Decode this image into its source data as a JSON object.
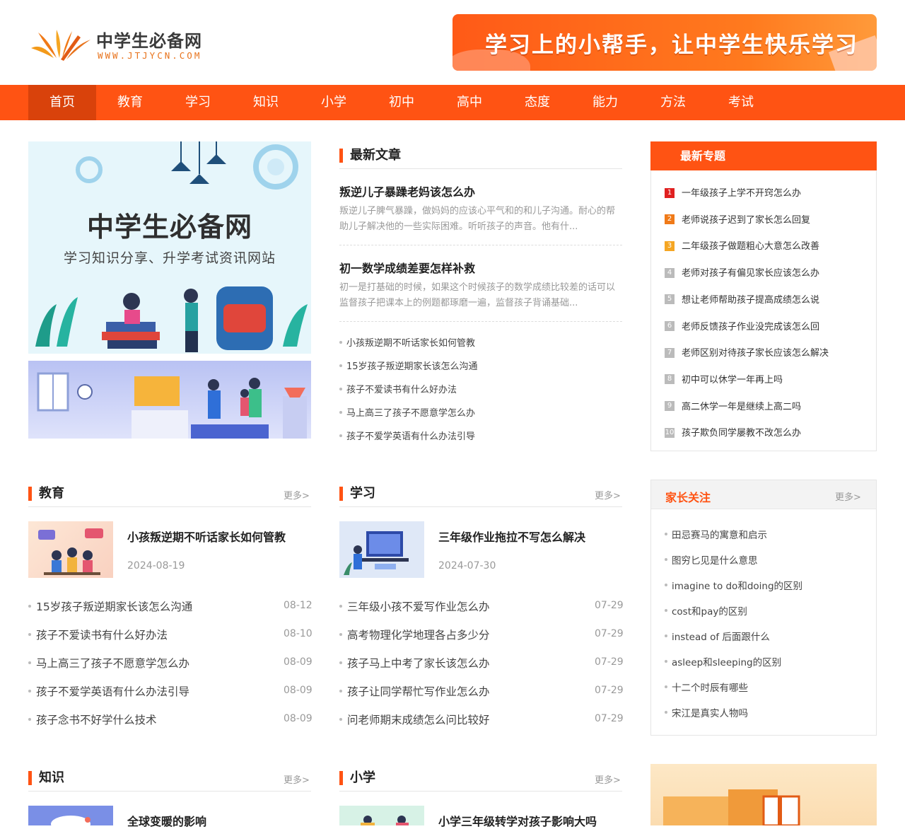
{
  "site": {
    "name": "中学生必备网",
    "domain": "WWW.JTJYCN.COM",
    "banner": "学习上的小帮手，让中学生快乐学习"
  },
  "nav": [
    "首页",
    "教育",
    "学习",
    "知识",
    "小学",
    "初中",
    "高中",
    "态度",
    "能力",
    "方法",
    "考试"
  ],
  "hero": {
    "title": "中学生必备网",
    "subtitle": "学习知识分享、升学考试资讯网站"
  },
  "latest": {
    "heading": "最新文章",
    "featured": [
      {
        "title": "叛逆儿子暴躁老妈该怎么办",
        "desc": "叛逆儿子脾气暴躁，做妈妈的应该心平气和的和儿子沟通。耐心的帮助儿子解决他的一些实际困难。听听孩子的声音。他有什..."
      },
      {
        "title": "初一数学成绩差要怎样补救",
        "desc": "初一是打基础的时候，如果这个时候孩子的数学成绩比较差的话可以监督孩子把课本上的例题都琢磨一遍，监督孩子背诵基础..."
      }
    ],
    "list": [
      "小孩叛逆期不听话家长如何管教",
      "15岁孩子叛逆期家长该怎么沟通",
      "孩子不爱读书有什么好办法",
      "马上高三了孩子不愿意学怎么办",
      "孩子不爱学英语有什么办法引导"
    ]
  },
  "topics": {
    "heading": "最新专题",
    "colors": [
      "#e02020",
      "#f07a18",
      "#f5a623",
      "#bbbbbb"
    ],
    "items": [
      "一年级孩子上学不开窍怎么办",
      "老师说孩子迟到了家长怎么回复",
      "二年级孩子做题粗心大意怎么改善",
      "老师对孩子有偏见家长应该怎么办",
      "想让老师帮助孩子提高成绩怎么说",
      "老师反馈孩子作业没完成该怎么回",
      "老师区别对待孩子家长应该怎么解决",
      "初中可以休学一年再上吗",
      "高二休学一年是继续上高二吗",
      "孩子欺负同学屡教不改怎么办"
    ]
  },
  "more_label": "更多>",
  "jiaoyu": {
    "heading": "教育",
    "featured": {
      "title": "小孩叛逆期不听话家长如何管教",
      "date": "2024-08-19"
    },
    "rows": [
      {
        "title": "15岁孩子叛逆期家长该怎么沟通",
        "date": "08-12"
      },
      {
        "title": "孩子不爱读书有什么好办法",
        "date": "08-10"
      },
      {
        "title": "马上高三了孩子不愿意学怎么办",
        "date": "08-09"
      },
      {
        "title": "孩子不爱学英语有什么办法引导",
        "date": "08-09"
      },
      {
        "title": "孩子念书不好学什么技术",
        "date": "08-09"
      }
    ]
  },
  "xuexi": {
    "heading": "学习",
    "featured": {
      "title": "三年级作业拖拉不写怎么解决",
      "date": "2024-07-30"
    },
    "rows": [
      {
        "title": "三年级小孩不爱写作业怎么办",
        "date": "07-29"
      },
      {
        "title": "高考物理化学地理各占多少分",
        "date": "07-29"
      },
      {
        "title": "孩子马上中考了家长该怎么办",
        "date": "07-29"
      },
      {
        "title": "孩子让同学帮忙写作业怎么办",
        "date": "07-29"
      },
      {
        "title": "问老师期末成绩怎么问比较好",
        "date": "07-29"
      }
    ]
  },
  "parents": {
    "heading": "家长关注",
    "items": [
      "田忌赛马的寓意和启示",
      "图穷匕见是什么意思",
      "imagine to do和doing的区别",
      "cost和pay的区别",
      "instead of 后面跟什么",
      "asleep和sleeping的区别",
      "十二个时辰有哪些",
      "宋江是真实人物吗"
    ]
  },
  "zhishi": {
    "heading": "知识",
    "featured": {
      "title": "全球变暖的影响"
    }
  },
  "xiaoxue": {
    "heading": "小学",
    "featured": {
      "title": "小学三年级转学对孩子影响大吗"
    }
  }
}
